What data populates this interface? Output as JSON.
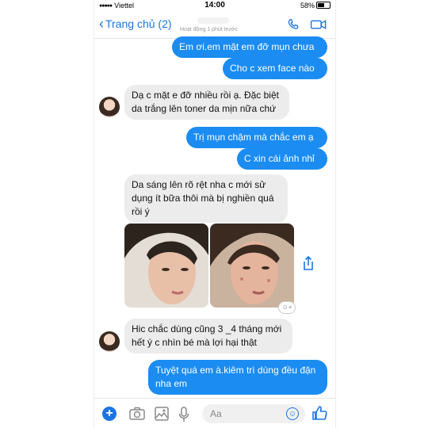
{
  "status_bar": {
    "carrier": "Viettel",
    "time": "14:00",
    "battery": "58%"
  },
  "header": {
    "back_label": "Trang chủ (2)",
    "presence": "Hoạt động 1 phút trước"
  },
  "messages": [
    {
      "direction": "out",
      "text": "Em ơi.em mặt em đỡ mụn chưa"
    },
    {
      "direction": "out",
      "text": "Cho c xem face nào"
    },
    {
      "direction": "in",
      "text": "Dạ c mặt e đỡ nhiều rồi ạ. Đặc biệt da trắng lên toner da mịn nữa chứ"
    },
    {
      "direction": "out",
      "text": "Trị mụn chậm mà chắc em ạ"
    },
    {
      "direction": "out",
      "text": "C xin cái ảnh nhỉ"
    },
    {
      "direction": "in",
      "text": "Da sáng lên rõ rệt nha c mới sử dụng ít bữa thôi mà bị nghiền quá rồi ý"
    },
    {
      "direction": "in",
      "text": "Hic chắc dùng cũng 3 _4 tháng mới hết ý c nhìn bé mà lợi hại thật"
    },
    {
      "direction": "out",
      "text": "Tuyệt quá em à.kiêm trì dùng đều đặn nha em"
    }
  ],
  "composer": {
    "placeholder": "Aa"
  },
  "colors": {
    "accent": "#1b74e4",
    "outgoing_bubble": "#1b8cf2",
    "incoming_bubble": "#ececec"
  },
  "icons": [
    "back-chevron-icon",
    "phone-icon",
    "video-camera-icon",
    "share-icon",
    "add-reaction-icon",
    "plus-icon",
    "camera-icon",
    "gallery-icon",
    "microphone-icon",
    "emoji-icon",
    "like-icon"
  ]
}
